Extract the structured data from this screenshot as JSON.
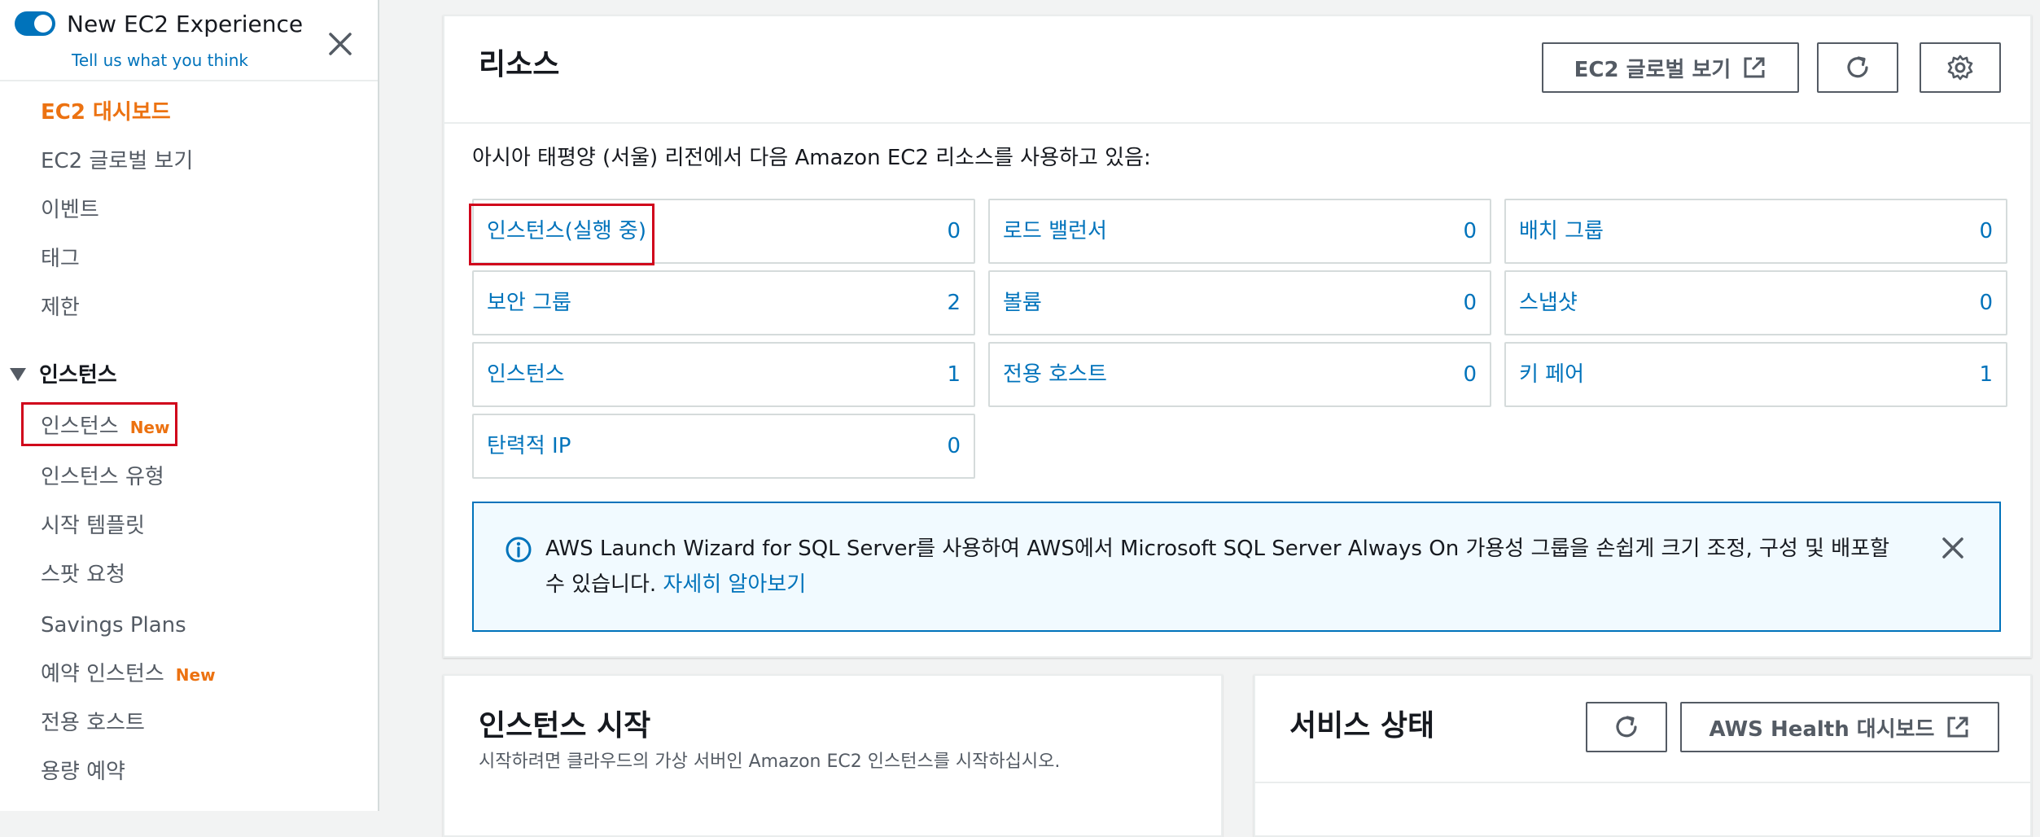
{
  "sidebar": {
    "experience_title": "New EC2 Experience",
    "experience_feedback": "Tell us what you think",
    "items": [
      {
        "label": "EC2 대시보드",
        "active": true
      },
      {
        "label": "EC2 글로벌 보기"
      },
      {
        "label": "이벤트"
      },
      {
        "label": "태그"
      },
      {
        "label": "제한"
      }
    ],
    "section_instances": "인스턴스",
    "instance_items": [
      {
        "label": "인스턴스",
        "badge": "New"
      },
      {
        "label": "인스턴스 유형"
      },
      {
        "label": "시작 템플릿"
      },
      {
        "label": "스팟 요청"
      },
      {
        "label": "Savings Plans"
      },
      {
        "label": "예약 인스턴스",
        "badge": "New"
      },
      {
        "label": "전용 호스트"
      },
      {
        "label": "용량 예약"
      }
    ]
  },
  "resources": {
    "title": "리소스",
    "global_view_button": "EC2 글로벌 보기",
    "description": "아시아 태평양 (서울) 리전에서 다음 Amazon EC2 리소스를 사용하고 있음:",
    "cells": [
      {
        "label": "인스턴스(실행 중)",
        "count": "0"
      },
      {
        "label": "로드 밸런서",
        "count": "0"
      },
      {
        "label": "배치 그룹",
        "count": "0"
      },
      {
        "label": "보안 그룹",
        "count": "2"
      },
      {
        "label": "볼륨",
        "count": "0"
      },
      {
        "label": "스냅샷",
        "count": "0"
      },
      {
        "label": "인스턴스",
        "count": "1"
      },
      {
        "label": "전용 호스트",
        "count": "0"
      },
      {
        "label": "키 페어",
        "count": "1"
      },
      {
        "label": "탄력적 IP",
        "count": "0"
      }
    ],
    "info_text": "AWS Launch Wizard for SQL Server를 사용하여 AWS에서 Microsoft SQL Server Always On 가용성 그룹을 손쉽게 크기 조정, 구성 및 배포할 수 있습니다.",
    "info_link": "자세히 알아보기"
  },
  "launch": {
    "title": "인스턴스 시작",
    "subtitle": "시작하려면 클라우드의 가상 서버인 Amazon EC2 인스턴스를 시작하십시오."
  },
  "health": {
    "title": "서비스 상태",
    "dashboard_button": "AWS Health 대시보드"
  },
  "colors": {
    "accent": "#0073bb",
    "active_nav": "#ec7211",
    "highlight": "#d0021b"
  }
}
